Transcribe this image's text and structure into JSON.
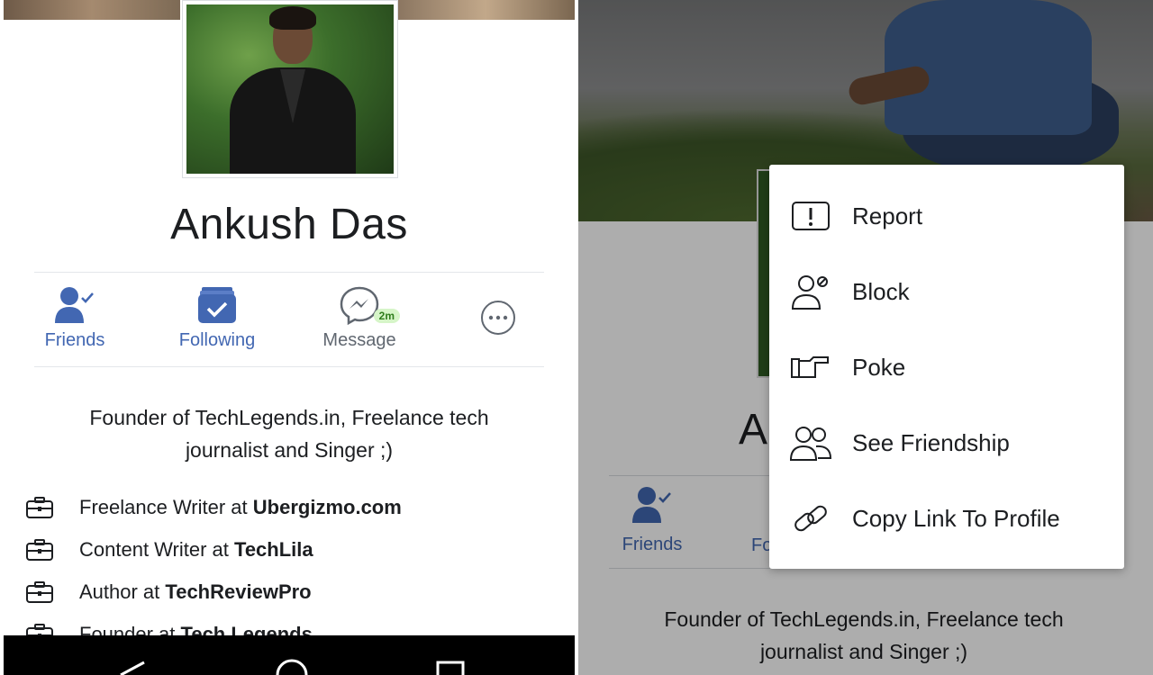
{
  "left": {
    "profile": {
      "name": "Ankush Das"
    },
    "actions": {
      "friends": "Friends",
      "following": "Following",
      "message": "Message",
      "message_badge": "2m"
    },
    "bio": {
      "line1": "Founder of TechLegends.in, Freelance tech",
      "line2": "journalist and Singer ;)"
    },
    "work": [
      {
        "role": "Freelance Writer at ",
        "org": "Ubergizmo.com"
      },
      {
        "role": "Content Writer at ",
        "org": "TechLila"
      },
      {
        "role": "Author at ",
        "org": "TechReviewPro"
      },
      {
        "role": "Founder at ",
        "org": "Tech Legends"
      }
    ]
  },
  "right": {
    "name_fragment": "A",
    "friends": "Friends",
    "following_fragment": "Fo",
    "bio": {
      "line1": "Founder of TechLegends.in, Freelance tech",
      "line2": "journalist and Singer ;)"
    },
    "menu": {
      "items": [
        {
          "label": "Report",
          "icon": "report-icon"
        },
        {
          "label": "Block",
          "icon": "block-icon"
        },
        {
          "label": "Poke",
          "icon": "poke-icon"
        },
        {
          "label": "See Friendship",
          "icon": "see-friendship-icon"
        },
        {
          "label": "Copy Link To Profile",
          "icon": "link-icon"
        }
      ]
    }
  },
  "colors": {
    "accent": "#4267b2",
    "text": "#1c1e21",
    "secondary_text": "#606770",
    "badge_bg": "#d6f5c8",
    "badge_text": "#2f7d1c"
  }
}
